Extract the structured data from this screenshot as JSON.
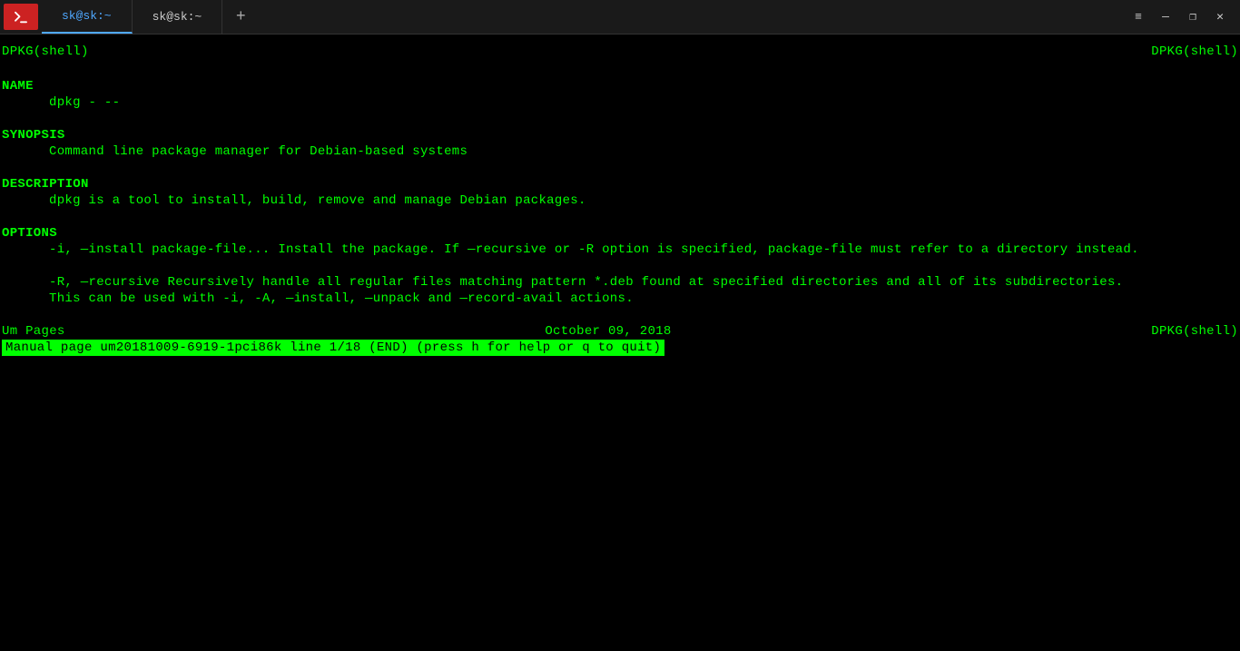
{
  "tabs": {
    "active": "sk@sk:~",
    "inactive": "sk@sk:~"
  },
  "man": {
    "header_left": "DPKG(shell)",
    "header_right": "DPKG(shell)",
    "name_section": "NAME",
    "name_text": "dpkg - --",
    "synopsis_section": "SYNOPSIS",
    "synopsis_text": "Command line package manager for Debian-based systems",
    "desc_section": "DESCRIPTION",
    "desc_text": "dpkg is a tool to install, build, remove and manage Debian packages.",
    "options_section": "OPTIONS",
    "option_i": "-i, —install package-file... Install the package. If —recursive or -R option is specified, package-file must refer to a directory instead.",
    "option_r_line1": "-R,  —recursive  Recursively  handle  all regular files matching pattern *.deb found at specified directories and all of its subdirectories.",
    "option_r_line2": "This can be used with -i, -A, —install, —unpack and —record-avail actions.",
    "footer_left": "Um Pages",
    "footer_center": "October 09, 2018",
    "footer_right": "DPKG(shell)",
    "status": " Manual page um20181009-6919-1pci86k line 1/18 (END) (press h for help or q to quit) "
  }
}
